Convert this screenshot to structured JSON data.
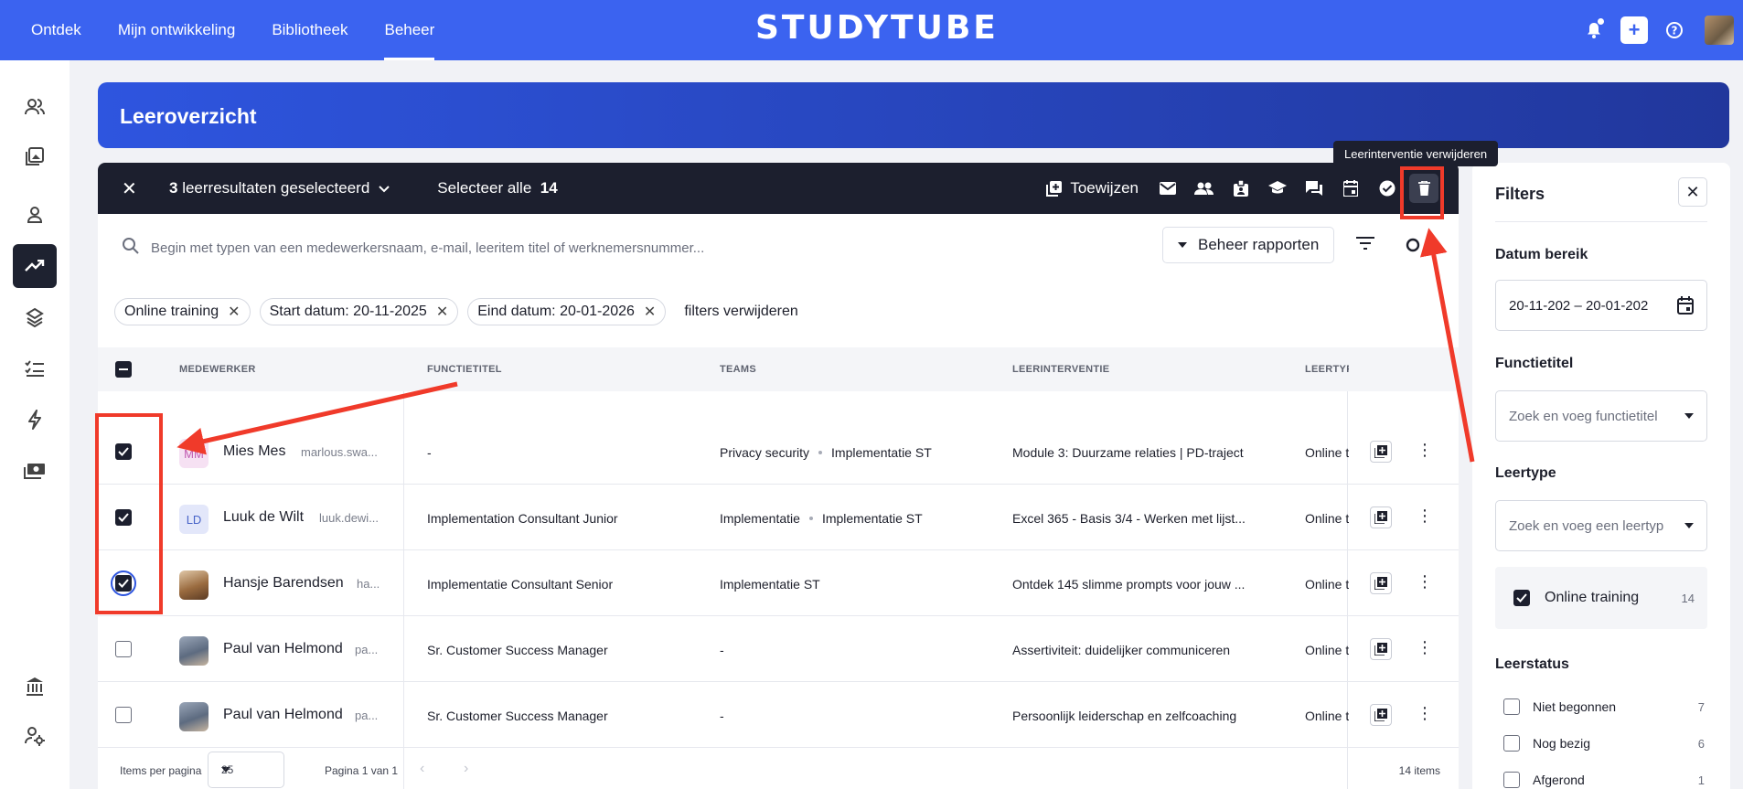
{
  "nav": {
    "links": [
      "Ontdek",
      "Mijn ontwikkeling",
      "Bibliotheek",
      "Beheer"
    ],
    "active": "Beheer",
    "logo": "STUDYTUBE"
  },
  "page": {
    "title": "Leeroverzicht"
  },
  "selection": {
    "count": "3",
    "count_label": "leerresultaten geselecteerd",
    "select_all_label": "Selecteer alle",
    "select_all_count": "14",
    "assign_label": "Toewijzen",
    "tooltip": "Leerinterventie verwijderen"
  },
  "search": {
    "placeholder": "Begin met typen van een medewerkersnaam, e-mail, leeritem titel of werknemersnummer...",
    "beheer_label": "Beheer rapporten"
  },
  "chips": [
    "Online training",
    "Start datum: 20-11-2025",
    "Eind datum: 20-01-2026"
  ],
  "clear_filters": "filters verwijderen",
  "table": {
    "columns": [
      "MEDEWERKER",
      "FUNCTIETITEL",
      "TEAMS",
      "LEERINTERVENTIE",
      "LEERTYP"
    ],
    "rows": [
      {
        "name": "Mies Mes",
        "email": "marlous.swa...",
        "initials": "MM",
        "func": "-",
        "teams": [
          "Privacy security",
          "Implementatie ST"
        ],
        "interv": "Module 3: Duurzame relaties | PD-traject",
        "type": "Online t",
        "checked": true
      },
      {
        "name": "Luuk de Wilt",
        "email": "luuk.dewi...",
        "initials": "LD",
        "func": "Implementation Consultant Junior",
        "teams": [
          "Implementatie",
          "Implementatie ST"
        ],
        "interv": "Excel 365 - Basis 3/4 - Werken met lijst...",
        "type": "Online t",
        "checked": true
      },
      {
        "name": "Hansje Barendsen",
        "email": "ha...",
        "initials": "",
        "func": "Implementatie Consultant Senior",
        "teams": [
          "Implementatie ST"
        ],
        "interv": "Ontdek 145 slimme prompts voor jouw ...",
        "type": "Online t",
        "checked": true
      },
      {
        "name": "Paul van Helmond",
        "email": "pa...",
        "initials": "",
        "func": "Sr. Customer Success Manager",
        "teams": [
          "-"
        ],
        "interv": "Assertiviteit: duidelijker communiceren",
        "type": "Online t",
        "checked": false
      },
      {
        "name": "Paul van Helmond",
        "email": "pa...",
        "initials": "",
        "func": "Sr. Customer Success Manager",
        "teams": [
          "-"
        ],
        "interv": "Persoonlijk leiderschap en zelfcoaching",
        "type": "Online t",
        "checked": false
      }
    ]
  },
  "footer": {
    "items_per_page_label": "Items per pagina",
    "per_page": "25",
    "page_info": "Pagina 1 van 1",
    "total": "14 items"
  },
  "filters": {
    "title": "Filters",
    "date_label": "Datum bereik",
    "date_value": "20-11-202 – 20-01-202",
    "func_label": "Functietitel",
    "func_placeholder": "Zoek en voeg functietitel",
    "type_label": "Leertype",
    "type_placeholder": "Zoek en voeg een leertyp",
    "type_option": "Online training",
    "type_option_count": "14",
    "status_label": "Leerstatus",
    "status_options": [
      {
        "label": "Niet begonnen",
        "count": "7"
      },
      {
        "label": "Nog bezig",
        "count": "6"
      },
      {
        "label": "Afgerond",
        "count": "1"
      }
    ]
  },
  "colors": {
    "brand": "#3b63f0",
    "dark": "#1c1f2e",
    "annotation": "#f03a2a"
  },
  "icons": [
    "bell-icon",
    "plus-icon",
    "help-icon",
    "mail-icon",
    "people-icon",
    "badge-icon",
    "graduation-icon",
    "chat-icon",
    "calendar-icon",
    "check-circle-icon",
    "trash-icon",
    "search-icon",
    "filter-icon",
    "settings-icon"
  ]
}
